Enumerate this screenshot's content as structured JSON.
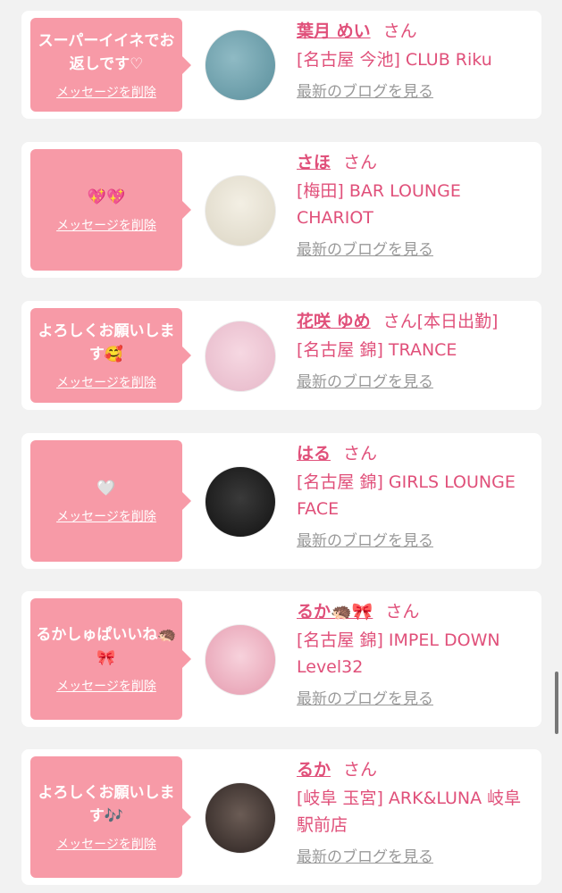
{
  "colors": {
    "accent": "#e0507a",
    "bubble": "#f79aa7",
    "muted": "#999999"
  },
  "delete_label": "メッセージを削除",
  "blog_label": "最新のブログを見る",
  "honorific": "さん",
  "items": [
    {
      "message": "スーパーイイネでお返しです♡",
      "name": "葉月 めい",
      "extra": "",
      "shop": "[名古屋 今池] CLUB Riku"
    },
    {
      "message": "💖💖",
      "name": "さほ",
      "extra": "",
      "shop": "[梅田] BAR LOUNGE CHARIOT"
    },
    {
      "message": "よろしくお願いします🥰",
      "name": "花咲 ゆめ",
      "extra": "[本日出勤]",
      "shop": "[名古屋 錦] TRANCE"
    },
    {
      "message": "🤍",
      "name": "はる",
      "extra": "",
      "shop": "[名古屋 錦] GIRLS LOUNGE FACE"
    },
    {
      "message": "るかしゅぱいいね🦔🎀",
      "name": "るか🦔🎀",
      "extra": "",
      "shop": "[名古屋 錦] IMPEL DOWN Level32"
    },
    {
      "message": "よろしくお願いします🎶",
      "name": "るか",
      "extra": "",
      "shop": "[岐阜 玉宮] ARK&LUNA 岐阜駅前店"
    }
  ]
}
